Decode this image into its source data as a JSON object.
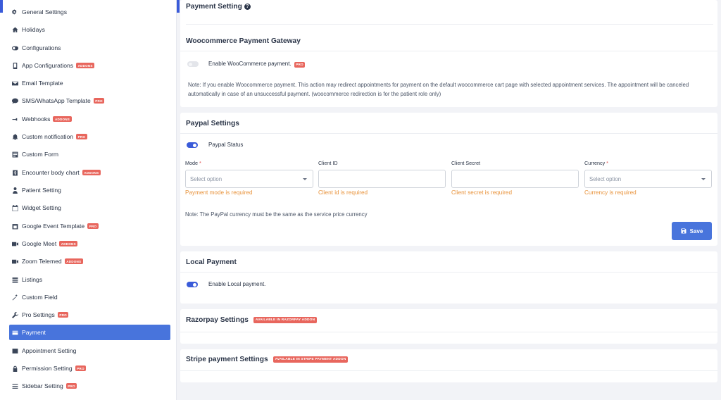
{
  "sidebar": {
    "items": [
      {
        "label": "General Settings",
        "icon": "gears-icon",
        "badge": ""
      },
      {
        "label": "Holidays",
        "icon": "home-icon",
        "badge": ""
      },
      {
        "label": "Configurations",
        "icon": "toggle-icon",
        "badge": ""
      },
      {
        "label": "App Configurations",
        "icon": "mobile-icon",
        "badge": "ADDONS"
      },
      {
        "label": "Email Template",
        "icon": "envelope-icon",
        "badge": ""
      },
      {
        "label": "SMS/WhatsApp Template",
        "icon": "chat-icon",
        "badge": "PRO"
      },
      {
        "label": "Webhooks",
        "icon": "usb-icon",
        "badge": "ADDONS"
      },
      {
        "label": "Custom notification",
        "icon": "bell-icon",
        "badge": "PRO"
      },
      {
        "label": "Custom Form",
        "icon": "form-icon",
        "badge": ""
      },
      {
        "label": "Encounter body chart",
        "icon": "body-chart-icon",
        "badge": "ADDONS"
      },
      {
        "label": "Patient Setting",
        "icon": "patient-icon",
        "badge": ""
      },
      {
        "label": "Widget Setting",
        "icon": "calendar-icon",
        "badge": ""
      },
      {
        "label": "Google Event Template",
        "icon": "google-calendar-icon",
        "badge": "PRO"
      },
      {
        "label": "Google Meet",
        "icon": "video-icon",
        "badge": "ADDONS"
      },
      {
        "label": "Zoom Telemed",
        "icon": "video-icon",
        "badge": "ADDONS"
      },
      {
        "label": "Listings",
        "icon": "list-icon",
        "badge": ""
      },
      {
        "label": "Custom Field",
        "icon": "magic-wand-icon",
        "badge": ""
      },
      {
        "label": "Pro Settings",
        "icon": "wrench-icon",
        "badge": "PRO"
      },
      {
        "label": "Payment",
        "icon": "payment-icon",
        "badge": ""
      },
      {
        "label": "Appointment Setting",
        "icon": "appointment-icon",
        "badge": ""
      },
      {
        "label": "Permission Setting",
        "icon": "lock-icon",
        "badge": "PRO"
      },
      {
        "label": "Sidebar Setting",
        "icon": "bars-icon",
        "badge": "PRO"
      }
    ]
  },
  "payment_setting": {
    "title": "Payment Setting",
    "help_glyph": "?"
  },
  "woocommerce": {
    "title": "Woocommerce Payment Gateway",
    "toggle_label": "Enable WooCommerce payment.",
    "toggle_on": false,
    "badge": "PRO",
    "note": "Note: If you enable Woocommerce payment. This action may redirect appointments for payment on the default woocommerce cart page with selected appointment services. The appointment will be canceled automatically in case of an unsuccessful payment. (woocommerce redirection is for the patient role only)"
  },
  "paypal": {
    "title": "Paypal Settings",
    "status_label": "Paypal Status",
    "status_on": true,
    "mode": {
      "label": "Mode",
      "required": "*",
      "placeholder": "Select option",
      "error": "Payment mode is required"
    },
    "client_id": {
      "label": "Client ID",
      "value": "",
      "error": "Client id is required"
    },
    "client_secret": {
      "label": "Client Secret",
      "value": "",
      "error": "Client secret is required"
    },
    "currency": {
      "label": "Currency",
      "required": "*",
      "placeholder": "Select option",
      "error": "Currency is required"
    },
    "note": "Note: The PayPal currency must be the same as the service price currency",
    "save_label": "Save"
  },
  "local_payment": {
    "title": "Local Payment",
    "toggle_label": "Enable Local payment.",
    "toggle_on": true
  },
  "razorpay": {
    "title": "Razorpay Settings",
    "badge": "AVAILABLE IN RAZORPAY ADDON"
  },
  "stripe": {
    "title": "Stripe payment Settings",
    "badge": "AVAILABLE IN STRIPE PAYMENT ADDON"
  },
  "colors": {
    "accent": "#4874dc",
    "error": "#e8923a",
    "badge": "#e8665d"
  }
}
